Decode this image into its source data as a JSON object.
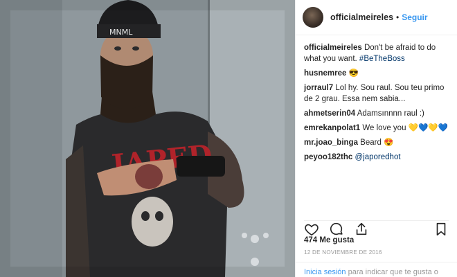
{
  "post": {
    "username": "officialmeireles",
    "follow_label": "Seguir",
    "separator": "•",
    "caption": {
      "user": "officialmeireles",
      "text": "Don't be afraid to do what you want.",
      "hashtag": "#BeTheBoss"
    },
    "comments": [
      {
        "user": "husnemree",
        "text": "😎"
      },
      {
        "user": "jorraul7",
        "text": "Lol hy. Sou raul. Sou teu primo de 2 grau. Essa nem sabia..."
      },
      {
        "user": "ahmetserin04",
        "text": "Adamsınnnn raul :)"
      },
      {
        "user": "emrekanpolat1",
        "text": "We love you 💛💙💛💙"
      },
      {
        "user": "mr.joao_binga",
        "text": "Beard 😍"
      },
      {
        "user": "peyoo182thc",
        "text": "",
        "mention": "@japoredhot"
      }
    ],
    "likes": "474 Me gusta",
    "date": "12 DE NOVIEMBRE DE 2016",
    "footer": {
      "login_label": "Inicia sesión",
      "rest": "para indicar que te gusta o"
    }
  },
  "photo": {
    "beanie_text": "MNML",
    "shirt_text": "JAPED"
  },
  "icons": {
    "like": "heart-icon",
    "comment": "comment-icon",
    "share": "share-icon",
    "save": "bookmark-icon"
  },
  "colors": {
    "link_blue": "#3897f0",
    "hashtag_blue": "#003569",
    "muted": "#999999",
    "text": "#262626"
  }
}
